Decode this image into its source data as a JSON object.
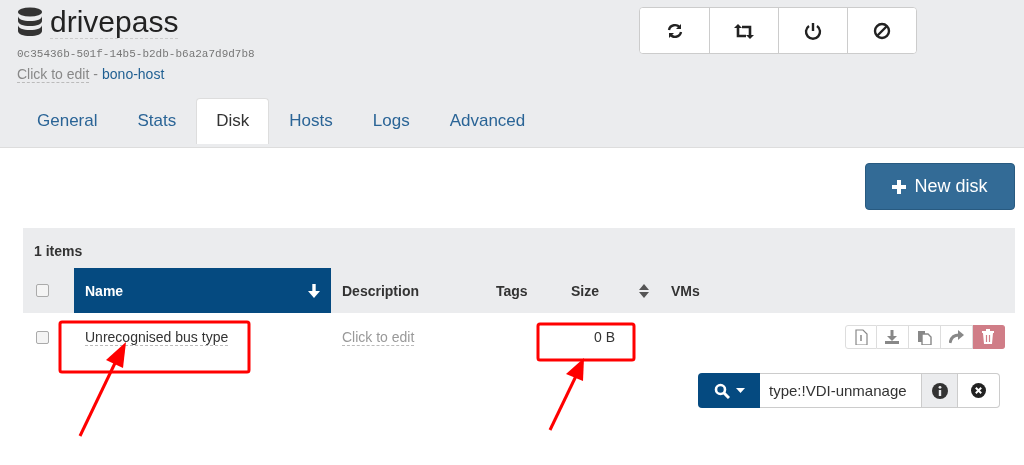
{
  "header": {
    "title": "drivepass",
    "uuid": "0c35436b-501f-14b5-b2db-b6a2a7d9d7b8",
    "description": "Click to edit",
    "separator": "-",
    "host": "bono-host"
  },
  "tabs": [
    {
      "label": "General",
      "selected": false
    },
    {
      "label": "Stats",
      "selected": false
    },
    {
      "label": "Disk",
      "selected": true
    },
    {
      "label": "Hosts",
      "selected": false
    },
    {
      "label": "Logs",
      "selected": false
    },
    {
      "label": "Advanced",
      "selected": false
    }
  ],
  "new_disk_button": "New disk",
  "table": {
    "count": "1 items",
    "select_all_checked": false,
    "columns": [
      {
        "label": "Name",
        "sortable": true,
        "sorted": true
      },
      {
        "label": "Description",
        "sortable": false,
        "sorted": false
      },
      {
        "label": "Tags",
        "sortable": false,
        "sorted": false
      },
      {
        "label": "Size",
        "sortable": true,
        "sorted": false
      },
      {
        "label": "VMs",
        "sortable": false,
        "sorted": false
      }
    ],
    "rows": [
      {
        "checked": false,
        "name": "Unrecognised bus type",
        "description": "Click to edit",
        "size": "0 B",
        "actions": [
          {
            "kind": "default"
          },
          {
            "kind": "default"
          },
          {
            "kind": "default"
          },
          {
            "kind": "default"
          },
          {
            "kind": "danger"
          }
        ]
      }
    ]
  },
  "filter": {
    "value": "type:!VDI-unmanage"
  }
}
